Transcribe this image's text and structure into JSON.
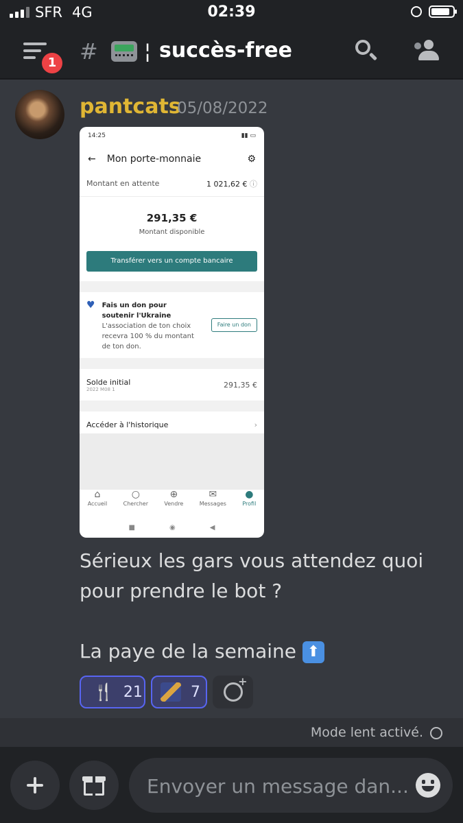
{
  "status": {
    "carrier": "SFR",
    "network": "4G",
    "time": "02:39"
  },
  "header": {
    "badge_count": "1",
    "channel_name": "succès-free"
  },
  "message": {
    "author": "pantcats",
    "date": "05/08/2022",
    "text_line1": "Sérieux les gars vous attendez quoi",
    "text_line2": "pour prendre le bot ?",
    "text_line3": "La paye de la semaine",
    "reactions": [
      {
        "emoji": "fork-and-knife",
        "count": "21"
      },
      {
        "emoji": "custom-image",
        "count": "7"
      }
    ]
  },
  "attachment": {
    "status_time": "14:25",
    "title": "Mon porte-monnaie",
    "pending_label": "Montant en attente",
    "pending_value": "1 021,62 €",
    "available_value": "291,35 €",
    "available_label": "Montant disponible",
    "transfer_button": "Transférer vers un compte bancaire",
    "donate_title": "Fais un don pour soutenir l'Ukraine",
    "donate_text": "L'association de ton choix recevra 100 % du montant de ton don.",
    "donate_button": "Faire un don",
    "initial_label": "Solde initial",
    "initial_sub": "2022 M08 1",
    "initial_value": "291,35 €",
    "history_link": "Accéder à l'historique",
    "nav": [
      "Accueil",
      "Chercher",
      "Vendre",
      "Messages",
      "Profil"
    ]
  },
  "slowmode": {
    "text": "Mode lent activé."
  },
  "composer": {
    "placeholder": "Envoyer un message dan..."
  }
}
